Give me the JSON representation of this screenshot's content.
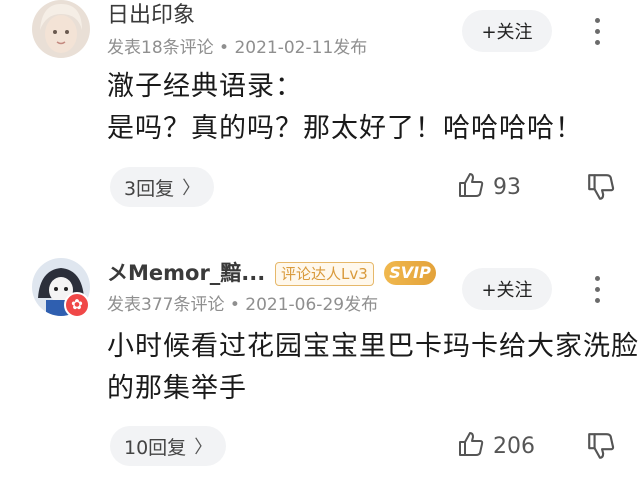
{
  "comments": [
    {
      "username": "日出印象",
      "meta": "发表18条评论 • 2021-02-11发布",
      "follow_label": "+关注",
      "content_lines": [
        "澈子经典语录：",
        "是吗？真的吗？那太好了！哈哈哈哈！"
      ],
      "reply_label": "3回复",
      "likes": "93"
    },
    {
      "username": "メMemor_黯...",
      "level_badge": "评论达人Lv3",
      "vip_badge": "SVIP",
      "meta": "发表377条评论 • 2021-06-29发布",
      "follow_label": "+关注",
      "content_lines": [
        "小时候看过花园宝宝里巴卡玛卡给大家洗脸",
        "的那集举手"
      ],
      "reply_label": "10回复",
      "likes": "206"
    }
  ],
  "icons": {
    "follow_plus": "plus-icon",
    "more": "more-vertical-icon",
    "like": "thumbs-up-icon",
    "dislike": "thumbs-down-icon",
    "reply_chevron": "chevron-right-icon",
    "vip_mark": "vip-badge-icon"
  },
  "colors": {
    "button_bg": "#f2f3f5",
    "meta_text": "#8f8f8f",
    "level_badge": "#d99a3c",
    "svip_badge": "#e3a23a",
    "vip_dot": "#f04848"
  }
}
